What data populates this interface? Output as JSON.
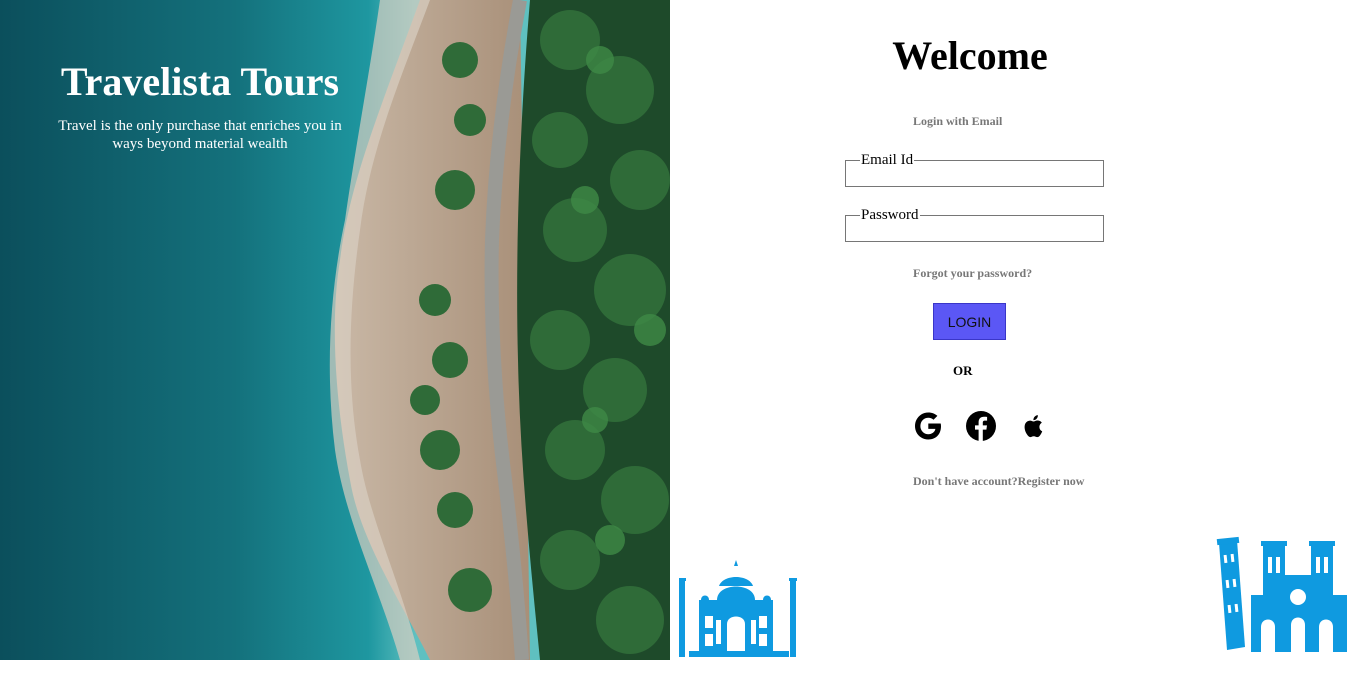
{
  "hero": {
    "title": "Travelista Tours",
    "tagline": "Travel is the only purchase that enriches you in ways beyond material wealth"
  },
  "form": {
    "heading": "Welcome",
    "login_with": "Login with Email",
    "email_legend": "Email Id",
    "password_legend": "Password",
    "email_value": "",
    "password_value": "",
    "forgot_link": "Forgot your password?",
    "login_button": "LOGIN",
    "or_text": "OR",
    "no_account_text": "Don't have account?",
    "register_link": "Register now"
  },
  "social": {
    "icons": [
      "google-icon",
      "facebook-icon",
      "apple-icon"
    ]
  },
  "colors": {
    "login_button_bg": "#5b57f5",
    "monument_blue": "#0f9ae0",
    "muted_text": "#777777"
  }
}
